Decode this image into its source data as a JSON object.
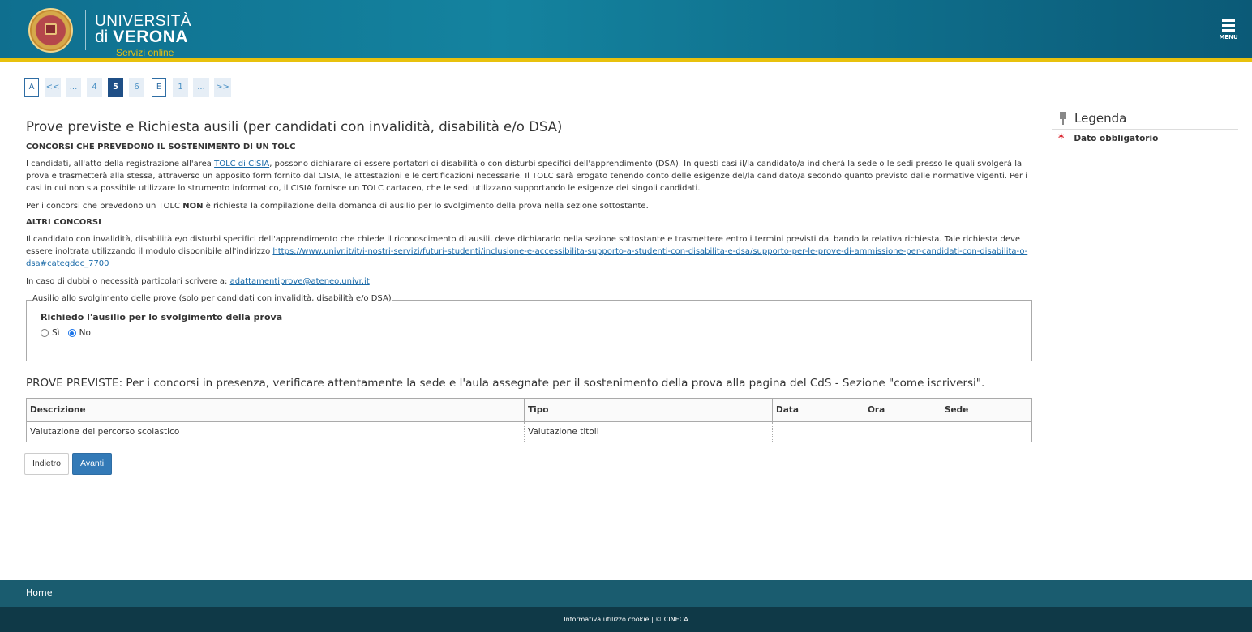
{
  "header": {
    "logo_line1": "UNIVERSITÀ",
    "logo_line2_prefix": "di",
    "logo_line2_bold": "VERONA",
    "logo_line3": "Servizi online",
    "menu_label": "MENU",
    "colors": {
      "primary": "#14839f",
      "accent": "#e8c10d"
    }
  },
  "pager": {
    "items": [
      {
        "label": "A",
        "state": "boxed"
      },
      {
        "label": "<<",
        "state": "normal"
      },
      {
        "label": "...",
        "state": "normal"
      },
      {
        "label": "4",
        "state": "normal"
      },
      {
        "label": "5",
        "state": "active"
      },
      {
        "label": "6",
        "state": "normal"
      },
      {
        "label": "E",
        "state": "boxed"
      },
      {
        "label": "1",
        "state": "normal"
      },
      {
        "label": "...",
        "state": "normal"
      },
      {
        "label": ">>",
        "state": "normal"
      }
    ]
  },
  "main": {
    "title": "Prove previste e Richiesta ausili (per candidati con invalidità, disabilità e/o DSA)",
    "section1": {
      "title": "CONCORSI CHE PREVEDONO IL SOSTENIMENTO DI UN TOLC",
      "p1_before": "I candidati, all'atto della registrazione all'area ",
      "p1_link": "TOLC di CISIA",
      "p1_after": ", possono dichiarare di essere portatori di disabilità o con disturbi specifici dell'apprendimento (DSA). In questi casi il/la candidato/a indicherà la sede o le sedi presso le quali svolgerà la prova e trasmetterà alla stessa, attraverso un apposito form fornito dal CISIA, le attestazioni e le certificazioni necessarie. Il TOLC sarà erogato tenendo conto delle esigenze del/la candidato/a secondo quanto previsto dalle normative vigenti. Per i casi in cui non sia possibile utilizzare lo strumento informatico, il CISIA fornisce un TOLC cartaceo, che le sedi utilizzano supportando le esigenze dei singoli candidati.",
      "p2_before": "Per i concorsi che prevedono un TOLC ",
      "p2_bold": "NON",
      "p2_after": " è richiesta la compilazione della domanda di ausilio per lo svolgimento della prova nella sezione sottostante."
    },
    "section2": {
      "title": "ALTRI CONCORSI",
      "p1_before": "Il candidato con invalidità, disabilità e/o disturbi specifici dell'apprendimento che chiede il riconoscimento di ausili, deve dichiararlo nella sezione sottostante e trasmettere entro i termini previsti dal bando la relativa richiesta. Tale richiesta deve essere inoltrata utilizzando il modulo disponibile all'indirizzo ",
      "p1_link": "https://www.univr.it/it/i-nostri-servizi/futuri-studenti/inclusione-e-accessibilita-supporto-a-studenti-con-disabilita-e-dsa/supporto-per-le-prove-di-ammissione-per-candidati-con-disabilita-o-dsa#categdoc_7700",
      "p2_before": "In caso di dubbi o necessità particolari scrivere a: ",
      "p2_link": "adattamentiprove@ateneo.univr.it"
    },
    "fieldset": {
      "legend": "Ausilio allo svolgimento delle prove (solo per candidati con invalidità, disabilità e/o DSA)",
      "question": "Richiedo l'ausilio per lo svolgimento della prova",
      "option_yes": "Sì",
      "option_no": "No",
      "selected": "No"
    },
    "prove_title": "PROVE PREVISTE: Per i concorsi in presenza, verificare attentamente la sede e l'aula assegnate per il sostenimento della prova alla pagina del CdS - Sezione \"come iscriversi\".",
    "table": {
      "headers": [
        "Descrizione",
        "Tipo",
        "Data",
        "Ora",
        "Sede"
      ],
      "rows": [
        [
          "Valutazione del percorso scolastico",
          "Valutazione titoli",
          "",
          "",
          ""
        ]
      ]
    },
    "buttons": {
      "back": "Indietro",
      "next": "Avanti"
    }
  },
  "legenda": {
    "title": "Legenda",
    "star": "*",
    "item": "Dato obbligatorio"
  },
  "footer": {
    "home": "Home",
    "bottom": "Informativa utilizzo cookie | © CINECA"
  }
}
